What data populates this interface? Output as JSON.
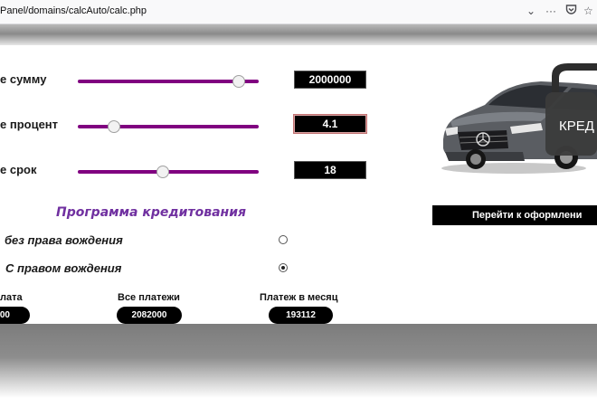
{
  "browser": {
    "url": "Panel/domains/calcAuto/calc.php"
  },
  "form": {
    "rows": [
      {
        "label": "е сумму",
        "value": "2000000",
        "slider_fraction": 0.9
      },
      {
        "label": "е процент",
        "value": "4.1",
        "slider_fraction": 0.2
      },
      {
        "label": "е срок",
        "value": "18",
        "slider_fraction": 0.47
      }
    ]
  },
  "program": {
    "title": "Программа кредитования",
    "options": [
      {
        "label": "без права вождения",
        "checked": false
      },
      {
        "label": "С правом вождения",
        "checked": true
      }
    ]
  },
  "summary": {
    "items": [
      {
        "label": "лата",
        "value": "00"
      },
      {
        "label": "Все платежи",
        "value": "2082000"
      },
      {
        "label": "Платеж в месяц",
        "value": "193112"
      }
    ]
  },
  "car_badge": "КРЕД",
  "apply_button": "Перейти к оформлени"
}
